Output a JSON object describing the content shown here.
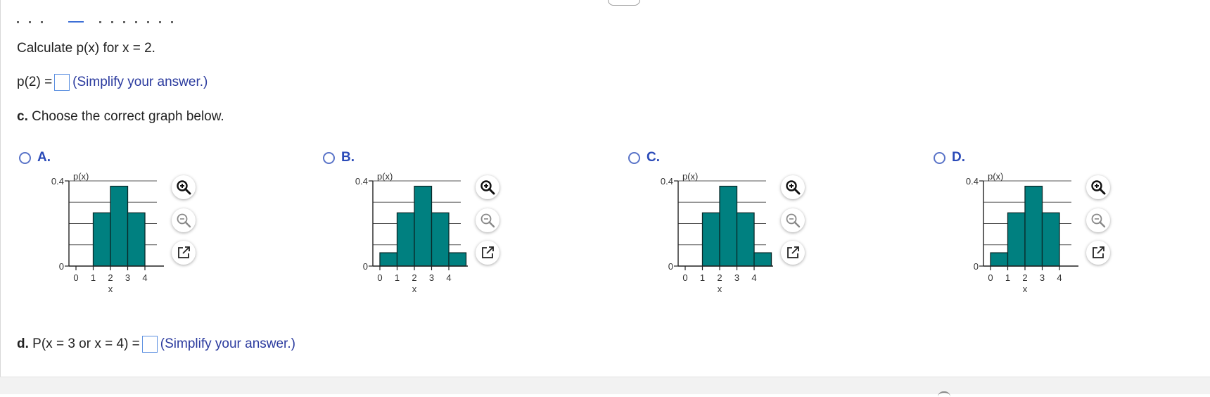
{
  "question": {
    "part_b_prompt": "Calculate p(x) for x = 2.",
    "part_b_lhs": "p(2) =",
    "part_b_hint": "(Simplify your answer.)",
    "part_c_letter": "c.",
    "part_c_prompt": "Choose the correct graph below.",
    "part_d_letter": "d.",
    "part_d_lhs": "P(x = 3 or x = 4) =",
    "part_d_hint": "(Simplify your answer.)"
  },
  "colors": {
    "bar_fill": "#008080",
    "bar_stroke": "#0a2a2a",
    "radio": "#5a74c8",
    "hint_text": "#2a3a9e"
  },
  "icons": {
    "zoom_in": "magnifier-plus-icon",
    "zoom_out": "magnifier-minus-icon",
    "popout": "external-window-icon"
  },
  "options": [
    {
      "label": "A.",
      "chart_data": {
        "type": "bar",
        "categories": [
          "0",
          "1",
          "2",
          "3",
          "4"
        ],
        "values": [
          0,
          0.25,
          0.375,
          0.25,
          0
        ],
        "ylabel": "p(x)",
        "xlabel": "x",
        "ylim": [
          0,
          0.4
        ],
        "y_tick_labels": [
          "0",
          "0.4"
        ]
      }
    },
    {
      "label": "B.",
      "chart_data": {
        "type": "bar",
        "categories": [
          "0",
          "1",
          "2",
          "3",
          "4"
        ],
        "values": [
          0.0625,
          0.25,
          0.375,
          0.25,
          0.0625
        ],
        "ylabel": "p(x)",
        "xlabel": "x",
        "ylim": [
          0,
          0.4
        ],
        "y_tick_labels": [
          "0",
          "0.4"
        ]
      }
    },
    {
      "label": "C.",
      "chart_data": {
        "type": "bar",
        "categories": [
          "0",
          "1",
          "2",
          "3",
          "4"
        ],
        "values": [
          0,
          0.25,
          0.375,
          0.25,
          0.0625
        ],
        "ylabel": "p(x)",
        "xlabel": "x",
        "ylim": [
          0,
          0.4
        ],
        "y_tick_labels": [
          "0",
          "0.4"
        ]
      }
    },
    {
      "label": "D.",
      "chart_data": {
        "type": "bar",
        "categories": [
          "0",
          "1",
          "2",
          "3",
          "4"
        ],
        "values": [
          0.0625,
          0.25,
          0.375,
          0.25,
          0
        ],
        "ylabel": "p(x)",
        "xlabel": "x",
        "ylim": [
          0,
          0.4
        ],
        "y_tick_labels": [
          "0",
          "0.4"
        ]
      }
    }
  ]
}
